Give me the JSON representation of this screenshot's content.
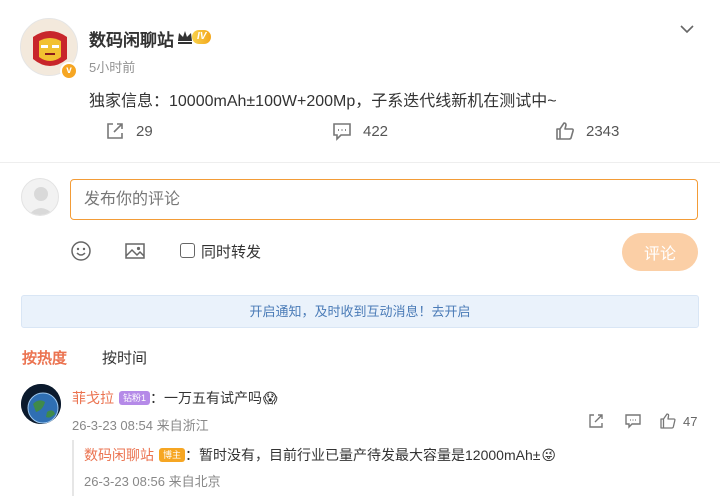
{
  "post": {
    "author": "数码闲聊站",
    "level": "IV",
    "time": "5小时前",
    "text": "独家信息：10000mAh±100W+200Mp，子系迭代线新机在测试中~",
    "verified_mark": "v",
    "repost_count": "29",
    "comment_count": "422",
    "like_count": "2343"
  },
  "composer": {
    "placeholder": "发布你的评论",
    "repost_label": "同时转发",
    "submit_label": "评论"
  },
  "notice": "开启通知，及时收到互动消息！去开启",
  "sort_tabs": {
    "hot": "按热度",
    "time": "按时间"
  },
  "comments": [
    {
      "user": "菲戈拉",
      "badge": "钻粉1",
      "text": "：一万五有试产吗",
      "emoji": "😱",
      "meta": "26-3-23 08:54 来自浙江",
      "likes": "47",
      "reply": {
        "user": "数码闲聊站",
        "tag": "博主",
        "text": "：暂时没有，目前行业已量产待发最大容量是12000mAh±",
        "emoji": "😜",
        "meta": "26-3-23 08:56 来自北京"
      }
    }
  ],
  "colors": {
    "accent_orange": "#eb7350",
    "input_border": "#f39c37",
    "submit_disabled": "#fbcfa6",
    "notice_bg": "#eaf2fb",
    "notice_text": "#4a7bb7"
  },
  "icons": [
    "chevron-down-icon",
    "repost-icon",
    "comment-icon",
    "like-icon",
    "emoji-icon",
    "image-icon",
    "share-icon"
  ]
}
